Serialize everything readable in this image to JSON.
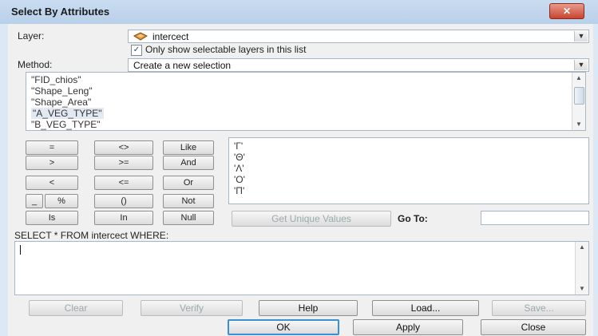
{
  "window": {
    "title": "Select By Attributes",
    "close_label": "✕"
  },
  "layer": {
    "label": "Layer:",
    "value": "intercect"
  },
  "only_selectable": {
    "label": "Only show selectable layers in this list",
    "checked": true
  },
  "method": {
    "label": "Method:",
    "value": "Create a new selection"
  },
  "fields": [
    "\"FID_chios\"",
    "\"Shape_Leng\"",
    "\"Shape_Area\"",
    "\"A_VEG_TYPE\"",
    "\"B_VEG_TYPE\""
  ],
  "operators": {
    "eq": "=",
    "ne": "<>",
    "like": "Like",
    "gt": ">",
    "ge": ">=",
    "and": "And",
    "lt": "<",
    "le": "<=",
    "or": "Or",
    "underscore": "_",
    "percent": "%",
    "parens": "()",
    "not": "Not",
    "is": "Is",
    "in": "In",
    "null": "Null"
  },
  "unique_values": [
    "'Γ'",
    "'Θ'",
    "'Λ'",
    "'Ο'",
    "'Π'"
  ],
  "get_unique_label": "Get Unique Values",
  "goto_label": "Go To:",
  "query_header": "SELECT * FROM intercect WHERE:",
  "buttons": {
    "clear": "Clear",
    "verify": "Verify",
    "help": "Help",
    "load": "Load...",
    "save": "Save..."
  },
  "footer": {
    "ok": "OK",
    "apply": "Apply",
    "close": "Close"
  },
  "colors": {
    "titlebar": "#c9dcf0",
    "close_button": "#c8452f",
    "ok_border": "#3c8fd1"
  }
}
